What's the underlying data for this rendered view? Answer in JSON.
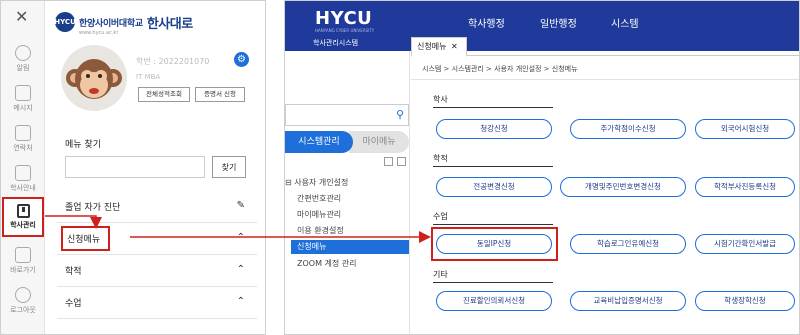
{
  "left": {
    "rail": {
      "close": "✕",
      "items": [
        {
          "label": "알림",
          "icon": "bell-icon"
        },
        {
          "label": "메시지",
          "icon": "mail-icon"
        },
        {
          "label": "연락처",
          "icon": "contact-icon"
        },
        {
          "label": "학사안내",
          "icon": "graduation-cap-icon"
        },
        {
          "label": "학사관리",
          "icon": "book-icon"
        },
        {
          "label": "바로가기",
          "icon": "external-link-icon"
        },
        {
          "label": "로그아웃",
          "icon": "logout-icon"
        }
      ]
    },
    "logo": {
      "kr": "한양사이버대학교",
      "brand": "한사대로",
      "url": "www.hycu.ac.kr",
      "mark": "HYCU"
    },
    "profile": {
      "id": "학번 : 2022201070",
      "dept": "IT MBA",
      "btn_grades": "전체성적조회",
      "btn_cert": "증명서 신청"
    },
    "menu_find": {
      "label": "메뉴 찾기",
      "button": "찾기",
      "placeholder": ""
    },
    "menu": [
      {
        "label": "졸업 자가 진단",
        "tail": "pin"
      },
      {
        "label": "신청메뉴",
        "tail": "collapse"
      },
      {
        "label": "학적",
        "tail": "collapse"
      },
      {
        "label": "수업",
        "tail": "collapse"
      }
    ]
  },
  "right": {
    "brand": {
      "name": "HYCU",
      "sub": "HANYANG CYBER UNIVERSITY",
      "system": "학사관리시스템"
    },
    "topnav": [
      "학사행정",
      "일반행정",
      "시스템"
    ],
    "tabs": {
      "active": "신청메뉴",
      "close": "✕"
    },
    "breadcrumb": "시스템 > 시스템관리 > 사용자 개인설정 > 신청메뉴",
    "side": {
      "search_placeholder": "",
      "tab_active": "시스템관리",
      "tab_inactive": "마이메뉴",
      "tree_root": "⊟ 사용자 개인설정",
      "tree_items": [
        "간편번호관리",
        "마이메뉴관리",
        "이용 환경설정",
        "신청메뉴",
        "ZOOM 계정 관리"
      ]
    },
    "sections": [
      {
        "title": "학사",
        "buttons": [
          "청강신청",
          "추가학점이수신청",
          "외국어시험신청"
        ]
      },
      {
        "title": "학적",
        "buttons": [
          "전공변경신청",
          "개명및주민번호변경신청",
          "학적부사진등록신청"
        ]
      },
      {
        "title": "수업",
        "buttons": [
          "동일IP신청",
          "학습로그인유예신청",
          "시험기간확인서발급"
        ]
      },
      {
        "title": "기타",
        "buttons": [
          "진료할인의뢰서신청",
          "교육비납입증명서신청",
          "학생장학신청"
        ]
      }
    ]
  },
  "colors": {
    "brand_blue": "#1f3a9b",
    "accent_blue": "#1e6fd9",
    "highlight_red": "#d0201c"
  }
}
